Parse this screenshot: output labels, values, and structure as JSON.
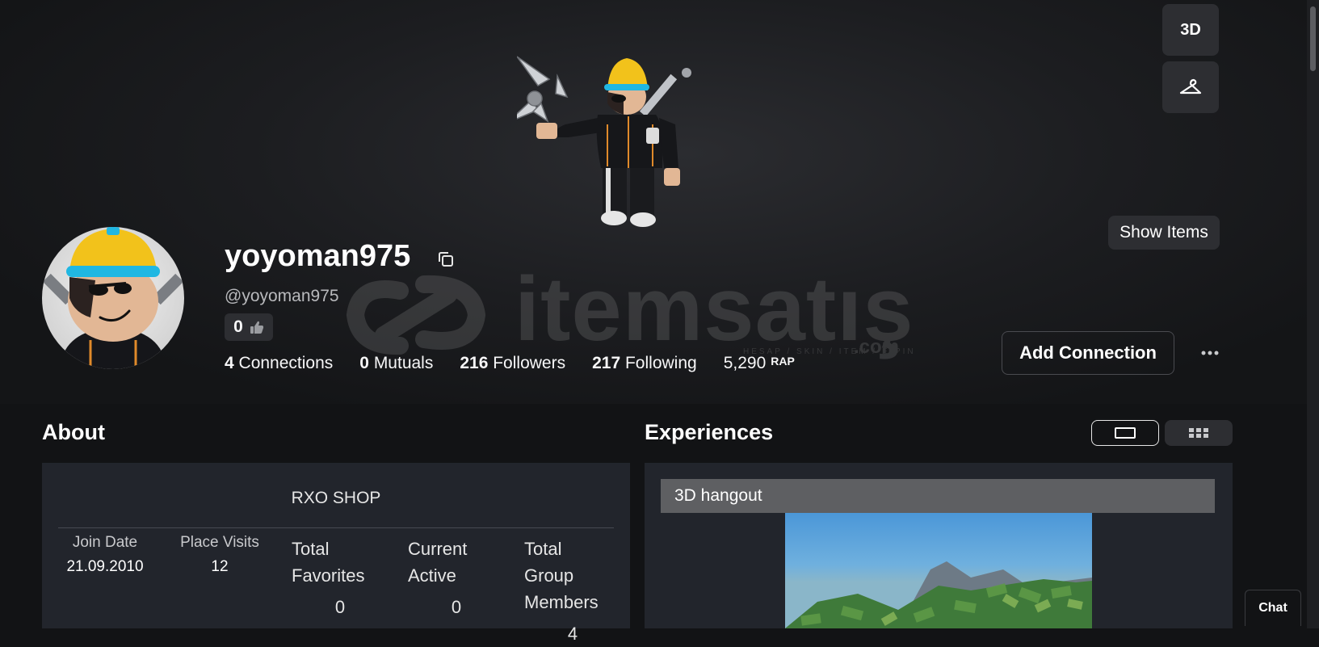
{
  "viewer": {
    "mode_button_label": "3D",
    "show_items_label": "Show Items"
  },
  "profile": {
    "display_name": "yoyoman975",
    "handle": "@yoyoman975",
    "likes": "0",
    "stats": {
      "connections_count": "4",
      "connections_label": "Connections",
      "mutuals_count": "0",
      "mutuals_label": "Mutuals",
      "followers_count": "216",
      "followers_label": "Followers",
      "following_count": "217",
      "following_label": "Following",
      "rap_value": "5,290",
      "rap_label": "RAP"
    },
    "add_connection_label": "Add Connection"
  },
  "watermark": {
    "brand": "itemsatış",
    "tld": ".com",
    "tagline": "HESAP / SKIN / ITEM / E-PIN"
  },
  "about": {
    "title": "About",
    "description": "RXO SHOP",
    "join_date_label": "Join Date",
    "join_date_value": "21.09.2010",
    "place_visits_label": "Place Visits",
    "place_visits_value": "12",
    "total_favorites_label_1": "Total",
    "total_favorites_label_2": "Favorites",
    "total_favorites_value": "0",
    "current_active_label_1": "Current",
    "current_active_label_2": "Active",
    "current_active_value": "0",
    "group_members_label_1": "Total",
    "group_members_label_2": "Group",
    "group_members_label_3": "Members",
    "group_members_value": "4"
  },
  "experiences": {
    "title": "Experiences",
    "active_view": "carousel",
    "featured_title": "3D hangout"
  },
  "chat": {
    "label": "Chat"
  },
  "colors": {
    "background": "#121315",
    "panel": "#22252c",
    "button": "#2d2e32",
    "title_bar": "#5e5f62"
  }
}
